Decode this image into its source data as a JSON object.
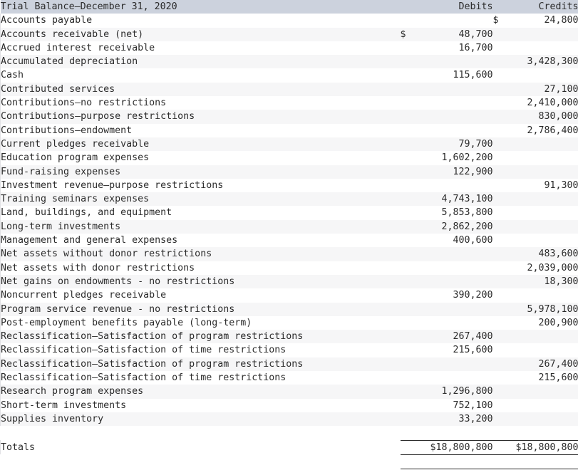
{
  "document": {
    "title": "Trial Balance–December 31, 2020"
  },
  "table": {
    "headers": {
      "account": "Trial Balance–December 31, 2020",
      "debits": "Debits",
      "credits": "Credits"
    },
    "currency_symbol": "$",
    "rows": [
      {
        "account": "Accounts payable",
        "debit_symbol": "",
        "debit": "",
        "credit_symbol": "$",
        "credit": "24,800"
      },
      {
        "account": "Accounts receivable (net)",
        "debit_symbol": "$",
        "debit": "48,700",
        "credit_symbol": "",
        "credit": ""
      },
      {
        "account": "Accrued interest receivable",
        "debit_symbol": "",
        "debit": "16,700",
        "credit_symbol": "",
        "credit": ""
      },
      {
        "account": "Accumulated depreciation",
        "debit_symbol": "",
        "debit": "",
        "credit_symbol": "",
        "credit": "3,428,300"
      },
      {
        "account": "Cash",
        "debit_symbol": "",
        "debit": "115,600",
        "credit_symbol": "",
        "credit": ""
      },
      {
        "account": "Contributed services",
        "debit_symbol": "",
        "debit": "",
        "credit_symbol": "",
        "credit": "27,100"
      },
      {
        "account": "Contributions–no restrictions",
        "debit_symbol": "",
        "debit": "",
        "credit_symbol": "",
        "credit": "2,410,000"
      },
      {
        "account": "Contributions–purpose restrictions",
        "debit_symbol": "",
        "debit": "",
        "credit_symbol": "",
        "credit": "830,000"
      },
      {
        "account": "Contributions–endowment",
        "debit_symbol": "",
        "debit": "",
        "credit_symbol": "",
        "credit": "2,786,400"
      },
      {
        "account": "Current pledges receivable",
        "debit_symbol": "",
        "debit": "79,700",
        "credit_symbol": "",
        "credit": ""
      },
      {
        "account": "Education program expenses",
        "debit_symbol": "",
        "debit": "1,602,200",
        "credit_symbol": "",
        "credit": ""
      },
      {
        "account": "Fund-raising expenses",
        "debit_symbol": "",
        "debit": "122,900",
        "credit_symbol": "",
        "credit": ""
      },
      {
        "account": "Investment revenue–purpose restrictions",
        "debit_symbol": "",
        "debit": "",
        "credit_symbol": "",
        "credit": "91,300"
      },
      {
        "account": "Training seminars expenses",
        "debit_symbol": "",
        "debit": "4,743,100",
        "credit_symbol": "",
        "credit": ""
      },
      {
        "account": "Land, buildings, and equipment",
        "debit_symbol": "",
        "debit": "5,853,800",
        "credit_symbol": "",
        "credit": ""
      },
      {
        "account": "Long-term investments",
        "debit_symbol": "",
        "debit": "2,862,200",
        "credit_symbol": "",
        "credit": ""
      },
      {
        "account": "Management and general expenses",
        "debit_symbol": "",
        "debit": "400,600",
        "credit_symbol": "",
        "credit": ""
      },
      {
        "account": "Net assets without donor restrictions",
        "debit_symbol": "",
        "debit": "",
        "credit_symbol": "",
        "credit": "483,600"
      },
      {
        "account": "Net assets with donor restrictions",
        "debit_symbol": "",
        "debit": "",
        "credit_symbol": "",
        "credit": "2,039,000"
      },
      {
        "account": "Net gains on endowments - no restrictions",
        "debit_symbol": "",
        "debit": "",
        "credit_symbol": "",
        "credit": "18,300"
      },
      {
        "account": "Noncurrent pledges receivable",
        "debit_symbol": "",
        "debit": "390,200",
        "credit_symbol": "",
        "credit": ""
      },
      {
        "account": "Program service revenue - no restrictions",
        "debit_symbol": "",
        "debit": "",
        "credit_symbol": "",
        "credit": "5,978,100"
      },
      {
        "account": "Post-employment benefits payable (long-term)",
        "debit_symbol": "",
        "debit": "",
        "credit_symbol": "",
        "credit": "200,900"
      },
      {
        "account": "Reclassification–Satisfaction of program restrictions",
        "debit_symbol": "",
        "debit": "267,400",
        "credit_symbol": "",
        "credit": ""
      },
      {
        "account": "Reclassification–Satisfaction of time restrictions",
        "debit_symbol": "",
        "debit": "215,600",
        "credit_symbol": "",
        "credit": ""
      },
      {
        "account": "Reclassification–Satisfaction of program restrictions",
        "debit_symbol": "",
        "debit": "",
        "credit_symbol": "",
        "credit": "267,400"
      },
      {
        "account": "Reclassification–Satisfaction of time restrictions",
        "debit_symbol": "",
        "debit": "",
        "credit_symbol": "",
        "credit": "215,600"
      },
      {
        "account": "Research program expenses",
        "debit_symbol": "",
        "debit": "1,296,800",
        "credit_symbol": "",
        "credit": ""
      },
      {
        "account": "Short-term investments",
        "debit_symbol": "",
        "debit": "752,100",
        "credit_symbol": "",
        "credit": ""
      },
      {
        "account": "Supplies inventory",
        "debit_symbol": "",
        "debit": "33,200",
        "credit_symbol": "",
        "credit": ""
      }
    ],
    "totals": {
      "label": "Totals",
      "debit": "$18,800,800",
      "credit": "$18,800,800"
    }
  }
}
